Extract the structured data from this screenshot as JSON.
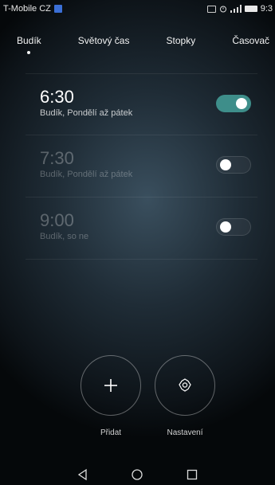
{
  "status_bar": {
    "carrier": "T-Mobile CZ",
    "time": "9:3"
  },
  "tabs": [
    {
      "label": "Budík",
      "active": true
    },
    {
      "label": "Světový čas",
      "active": false
    },
    {
      "label": "Stopky",
      "active": false
    },
    {
      "label": "Časovač",
      "active": false
    }
  ],
  "alarms": [
    {
      "time": "6:30",
      "label": "Budík, Pondělí až pátek",
      "enabled": true
    },
    {
      "time": "7:30",
      "label": "Budík, Pondělí až pátek",
      "enabled": false
    },
    {
      "time": "9:00",
      "label": "Budík, so ne",
      "enabled": false
    }
  ],
  "actions": {
    "add_label": "Přidat",
    "settings_label": "Nastavení"
  },
  "colors": {
    "toggle_on": "#3e8e8a",
    "accent": "#ffffff"
  }
}
